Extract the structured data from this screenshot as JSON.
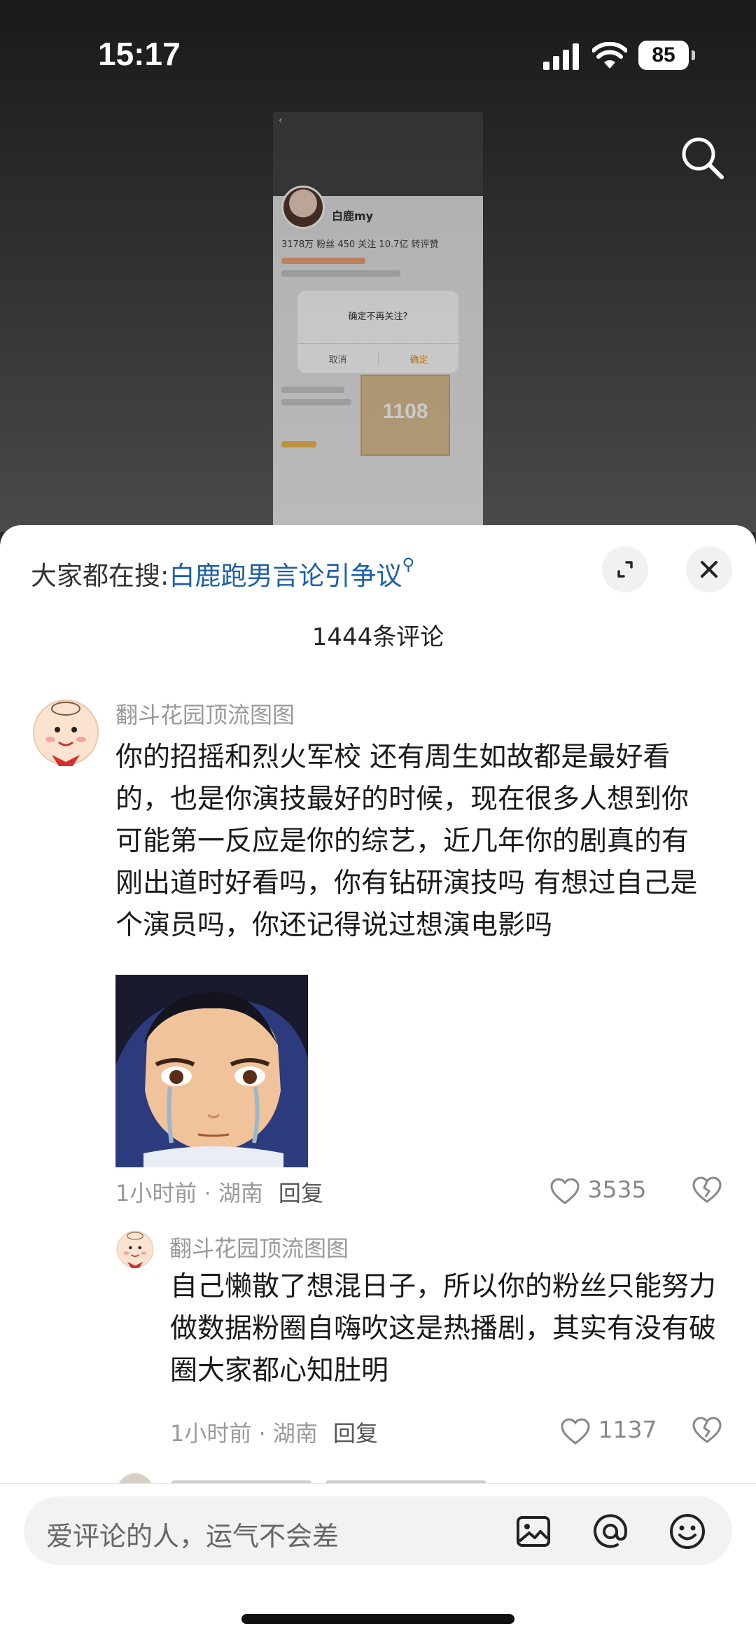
{
  "status_bar": {
    "time": "15:17",
    "battery": "85"
  },
  "preview": {
    "username": "白鹿my",
    "stats": "3178万 粉丝  450 关注  10.7亿 转评赞",
    "dialog_title": "确定不再关注?",
    "dialog_cancel": "取消",
    "dialog_confirm": "确定",
    "ticket_number": "1108"
  },
  "trending": {
    "prefix": "大家都在搜:",
    "topic": "白鹿跑男言论引争议"
  },
  "comment_count": "1444条评论",
  "comments": [
    {
      "username": "翻斗花园顶流图图",
      "text": "你的招摇和烈火军校 还有周生如故都是最好看的，也是你演技最好的时候，现在很多人想到你可能第一反应是你的综艺，近几年你的剧真的有刚出道时好看吗，你有钻研演技吗 有想过自己是个演员吗，你还记得说过想演电影吗",
      "time_location": "1小时前 · 湖南",
      "reply_label": "回复",
      "likes": "3535"
    },
    {
      "username": "翻斗花园顶流图图",
      "text": "自己懒散了想混日子，所以你的粉丝只能努力做数据粉圈自嗨吹这是热播剧，其实有没有破圈大家都心知肚明",
      "time_location": "1小时前 · 湖南",
      "reply_label": "回复",
      "likes": "1137"
    }
  ],
  "input_bar": {
    "placeholder": "爱评论的人，运气不会差"
  },
  "colors": {
    "link": "#1e5fa8",
    "muted": "#999999",
    "text": "#1a1a1a"
  },
  "icons": [
    "search-icon",
    "expand-icon",
    "close-icon",
    "heart-icon",
    "broken-heart-icon",
    "image-icon",
    "at-icon",
    "emoji-icon"
  ]
}
